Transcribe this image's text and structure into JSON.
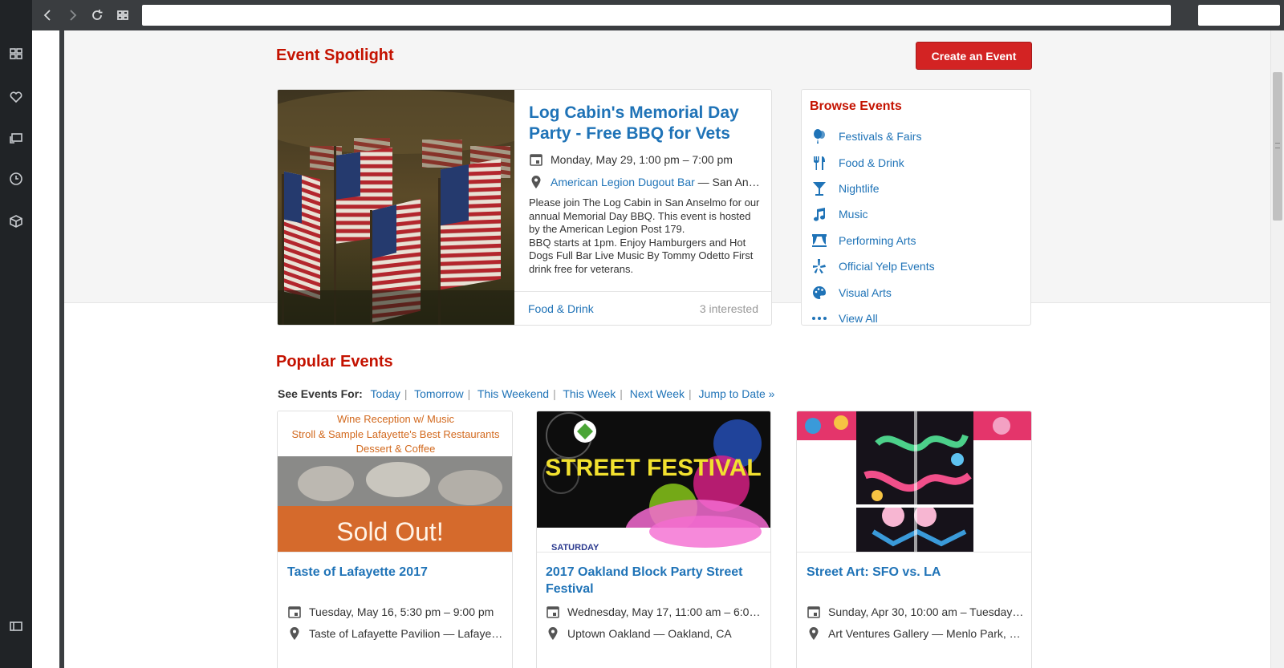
{
  "browser": {
    "url": "",
    "search": ""
  },
  "page": {
    "spotlight_heading": "Event Spotlight",
    "create_button": "Create an Event",
    "spotlight": {
      "title": "Log Cabin's Memorial Day Party - Free BBQ for Vets",
      "date": "Monday, May 29, 1:00 pm – 7:00 pm",
      "venue": "American Legion Dugout Bar",
      "location": " — San An…",
      "description": "Please join The Log Cabin in San Anselmo for our annual Memorial Day BBQ. This event is hosted by the American Legion Post 179.\n BBQ starts at 1pm.  Enjoy Hamburgers and Hot Dogs Full Bar Live Music By Tommy Odetto  First drink free for veterans.",
      "category": "Food & Drink",
      "interested": "3 interested"
    },
    "browse": {
      "title": "Browse Events",
      "items": [
        {
          "label": "Festivals & Fairs",
          "icon": "balloons-icon"
        },
        {
          "label": "Food & Drink",
          "icon": "fork-knife-icon"
        },
        {
          "label": "Nightlife",
          "icon": "cocktail-icon"
        },
        {
          "label": "Music",
          "icon": "music-note-icon"
        },
        {
          "label": "Performing Arts",
          "icon": "stage-curtain-icon"
        },
        {
          "label": "Official Yelp Events",
          "icon": "yelp-burst-icon"
        },
        {
          "label": "Visual Arts",
          "icon": "palette-icon"
        },
        {
          "label": "View All",
          "icon": "more-dots-icon"
        }
      ]
    },
    "popular_heading": "Popular Events",
    "see_events": {
      "label": "See Events For:",
      "links": [
        "Today",
        "Tomorrow",
        "This Weekend",
        "This Week",
        "Next Week",
        "Jump to Date »"
      ]
    },
    "events": [
      {
        "title": "Taste of Lafayette 2017",
        "date": "Tuesday, May 16, 5:30 pm – 9:00 pm",
        "place": "Taste of Lafayette Pavilion — Lafaye…",
        "img_text": [
          "Wine Reception w/ Music",
          "Stroll & Sample Lafayette's Best Restaurants",
          "Dessert & Coffee",
          "Sold Out!"
        ]
      },
      {
        "title": "2017 Oakland Block Party Street Festival",
        "date": "Wednesday, May 17, 11:00 am – 6:0…",
        "place": "Uptown Oakland — Oakland, CA",
        "img_text": [
          "STREET FESTIVAL",
          "SATURDAY"
        ]
      },
      {
        "title": "Street Art: SFO vs. LA",
        "date": "Sunday, Apr 30, 10:00 am – Tuesday…",
        "place": "Art Ventures Gallery — Menlo Park, …",
        "img_text": []
      }
    ]
  },
  "colors": {
    "brand_red": "#d32323",
    "heading_red": "#c41200",
    "link_blue": "#1f73b7"
  }
}
